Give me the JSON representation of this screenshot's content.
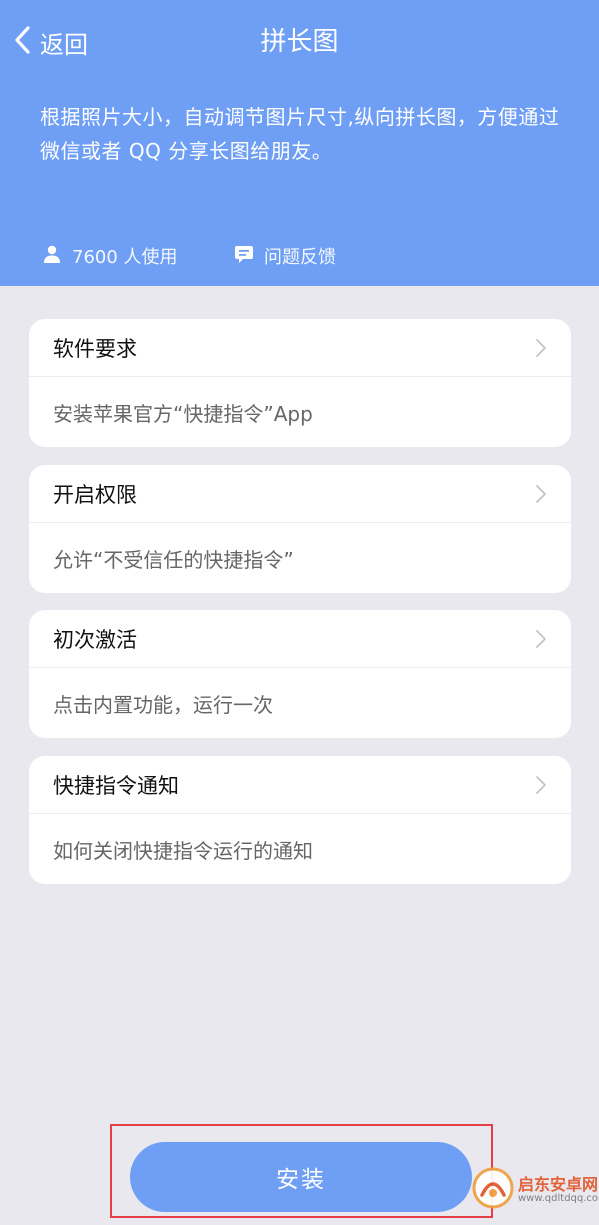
{
  "nav": {
    "back_label": "返回",
    "title": "拼长图"
  },
  "header": {
    "description": "根据照片大小，自动调节图片尺寸,纵向拼长图，方便通过微信或者 QQ 分享长图给朋友。",
    "usage_count": "7600 人使用",
    "feedback_label": "问题反馈",
    "background_color": "#6f9ff5"
  },
  "cards": [
    {
      "title": "软件要求",
      "subtitle": "安装苹果官方“快捷指令”App"
    },
    {
      "title": "开启权限",
      "subtitle": "允许“不受信任的快捷指令”"
    },
    {
      "title": "初次激活",
      "subtitle": "点击内置功能，运行一次"
    },
    {
      "title": "快捷指令通知",
      "subtitle": "如何关闭快捷指令运行的通知"
    }
  ],
  "install_button": {
    "label": "安装",
    "color": "#6f9ff5",
    "highlight_color": "#e43f45"
  },
  "watermark": {
    "name": "启东安卓网",
    "url": "www.qdltdqq.com"
  },
  "icons": {
    "back": "chevron-left-icon",
    "users": "person-icon",
    "feedback": "chat-bubble-icon",
    "card_arrow": "chevron-right-icon"
  }
}
